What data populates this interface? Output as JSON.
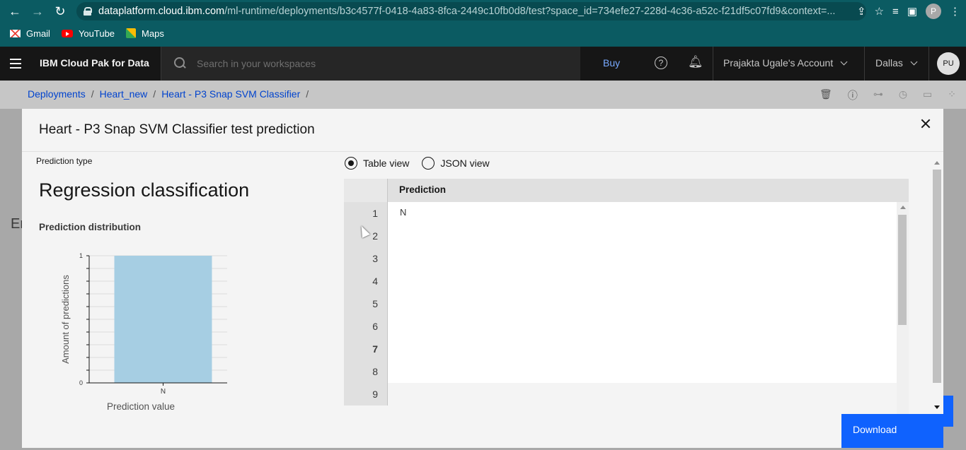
{
  "browser": {
    "url_host": "dataplatform.cloud.ibm.com",
    "url_path": "/ml-runtime/deployments/b3c4577f-0418-4a83-8fca-2449c10fb0d8/test?space_id=734efe27-228d-4c36-a52c-f21df5c07fd9&context=...",
    "profile_initial": "P",
    "bookmarks": [
      "Gmail",
      "YouTube",
      "Maps"
    ]
  },
  "header": {
    "brand": "IBM Cloud Pak for Data",
    "search_placeholder": "Search in your workspaces",
    "buy": "Buy",
    "account": "Prajakta Ugale's Account",
    "region": "Dallas",
    "user_initials": "PU"
  },
  "breadcrumb": {
    "items": [
      "Deployments",
      "Heart_new",
      "Heart - P3 Snap SVM Classifier"
    ],
    "separator": "/"
  },
  "background": {
    "partial_text": "Er"
  },
  "modal": {
    "title": "Heart - P3 Snap SVM Classifier test prediction",
    "prediction_type_label": "Prediction type",
    "prediction_type": "Regression classification",
    "distribution_title": "Prediction distribution",
    "view_options": [
      "Table view",
      "JSON view"
    ],
    "selected_view": "Table view",
    "table": {
      "column": "Prediction",
      "rows": [
        {
          "index": "1",
          "value": "N"
        },
        {
          "index": "2",
          "value": ""
        },
        {
          "index": "3",
          "value": ""
        },
        {
          "index": "4",
          "value": ""
        },
        {
          "index": "5",
          "value": ""
        },
        {
          "index": "6",
          "value": ""
        },
        {
          "index": "7",
          "value": ""
        },
        {
          "index": "8",
          "value": ""
        },
        {
          "index": "9",
          "value": ""
        }
      ]
    },
    "download_label": "Download"
  },
  "chart_data": {
    "type": "bar",
    "categories": [
      "N"
    ],
    "values": [
      1
    ],
    "xlabel": "Prediction value",
    "ylabel": "Amount of predictions",
    "ylim": [
      0,
      1
    ],
    "yticks": [
      "0",
      "1"
    ],
    "bar_color": "#a6cee3"
  },
  "colors": {
    "accent": "#0f62fe",
    "link": "#0043ce",
    "chrome": "#0b5b62"
  }
}
